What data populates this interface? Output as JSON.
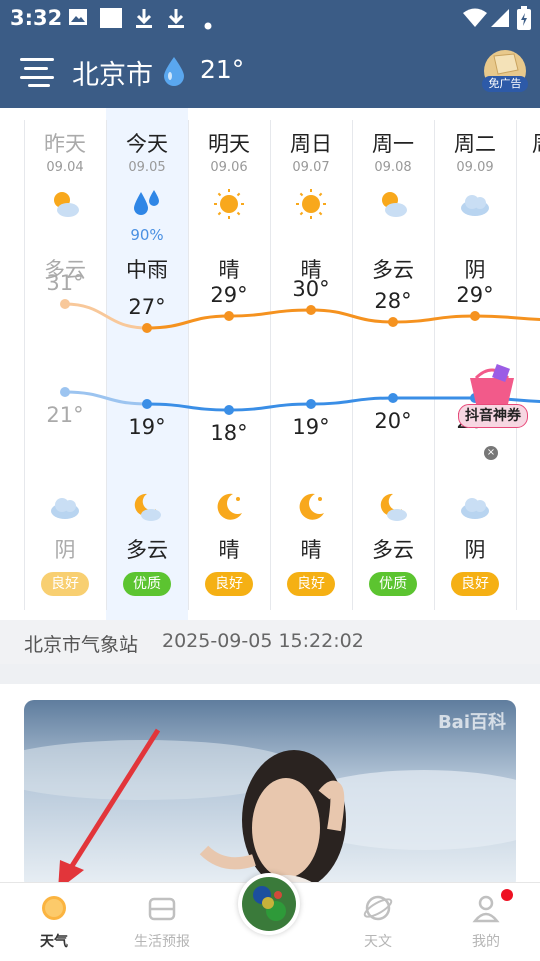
{
  "status_bar": {
    "time": "3:32"
  },
  "header": {
    "city": "北京市",
    "temperature": "21°",
    "no_ad_label": "免广告"
  },
  "forecast": [
    {
      "day": "昨天",
      "date": "09.04",
      "icon_day": "partly-cloudy-icon",
      "precip": "",
      "cond_day": "多云",
      "high": "31°",
      "low": "21°",
      "icon_night": "cloudy-icon",
      "cond_night": "阴",
      "aqi": "良好",
      "aqi_color": "#f5b014",
      "past": true
    },
    {
      "day": "今天",
      "date": "09.05",
      "icon_day": "rain-icon",
      "precip": "90%",
      "cond_day": "中雨",
      "high": "27°",
      "low": "19°",
      "icon_night": "moon-cloud-icon",
      "cond_night": "多云",
      "aqi": "优质",
      "aqi_color": "#5cc430",
      "past": false
    },
    {
      "day": "明天",
      "date": "09.06",
      "icon_day": "sun-icon",
      "precip": "",
      "cond_day": "晴",
      "high": "29°",
      "low": "18°",
      "icon_night": "moon-icon",
      "cond_night": "晴",
      "aqi": "良好",
      "aqi_color": "#f5b014",
      "past": false
    },
    {
      "day": "周日",
      "date": "09.07",
      "icon_day": "sun-icon",
      "precip": "",
      "cond_day": "晴",
      "high": "30°",
      "low": "19°",
      "icon_night": "moon-icon",
      "cond_night": "晴",
      "aqi": "良好",
      "aqi_color": "#f5b014",
      "past": false
    },
    {
      "day": "周一",
      "date": "09.08",
      "icon_day": "partly-cloudy-icon",
      "precip": "",
      "cond_day": "多云",
      "high": "28°",
      "low": "20°",
      "icon_night": "moon-cloud-icon",
      "cond_night": "多云",
      "aqi": "优质",
      "aqi_color": "#5cc430",
      "past": false
    },
    {
      "day": "周二",
      "date": "09.09",
      "icon_day": "cloudy-icon",
      "precip": "",
      "cond_day": "阴",
      "high": "29°",
      "low": "20°",
      "icon_night": "cloudy-icon",
      "cond_night": "阴",
      "aqi": "良好",
      "aqi_color": "#f5b014",
      "past": false
    }
  ],
  "ad": {
    "label": "抖音神券"
  },
  "station": {
    "name": "北京市气象站",
    "time": "2025-09-05 15:22:02"
  },
  "photo": {
    "watermark": "Bai百科"
  },
  "bottom_nav": [
    {
      "label": "天气",
      "icon": "sun-icon",
      "active": true
    },
    {
      "label": "生活预报",
      "icon": "wallet-icon",
      "active": false
    },
    {
      "label": "",
      "icon": "radar-icon",
      "active": false
    },
    {
      "label": "天文",
      "icon": "planet-icon",
      "active": false
    },
    {
      "label": "我的",
      "icon": "user-icon",
      "active": false
    }
  ]
}
